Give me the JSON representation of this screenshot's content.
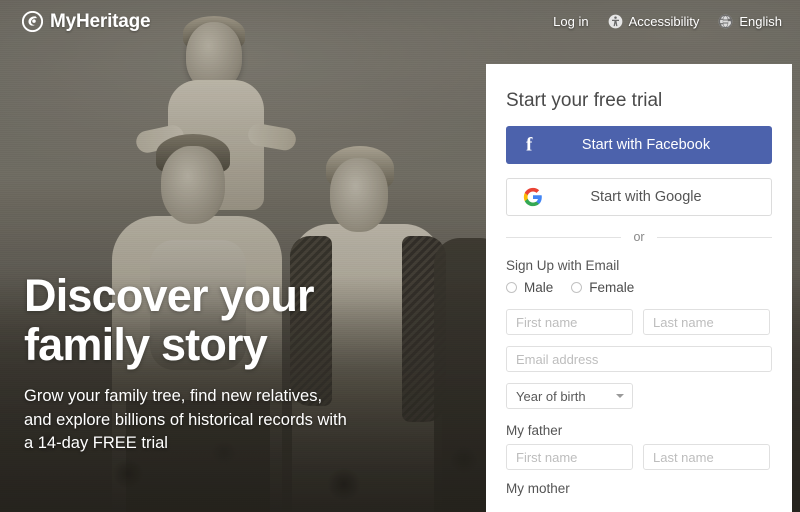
{
  "brand": {
    "name": "MyHeritage",
    "logo_icon": "myheritage-circle-leaf-icon"
  },
  "header": {
    "nav": [
      {
        "label": "Log in",
        "icon": null
      },
      {
        "label": "Accessibility",
        "icon": "accessibility-person-icon"
      },
      {
        "label": "English",
        "icon": "globe-icon"
      }
    ]
  },
  "hero": {
    "title_line1": "Discover your",
    "title_line2": "family story",
    "subtitle_line1": "Grow your family tree, find new relatives,",
    "subtitle_line2": "and explore billions of historical records with",
    "subtitle_line3": "a 14-day FREE trial"
  },
  "signup": {
    "title": "Start your free trial",
    "facebook_button": {
      "label": "Start with Facebook",
      "icon": "facebook-f-icon",
      "color": "#4c62ac"
    },
    "google_button": {
      "label": "Start with Google",
      "icon": "google-g-icon",
      "color": "#ffffff"
    },
    "divider_text": "or",
    "email_section_label": "Sign Up with Email",
    "gender": {
      "male_label": "Male",
      "female_label": "Female",
      "selected": null
    },
    "fields": {
      "first_name_placeholder": "First name",
      "last_name_placeholder": "Last name",
      "email_placeholder": "Email address",
      "first_name_value": "",
      "last_name_value": "",
      "email_value": ""
    },
    "year_of_birth": {
      "label": "Year of birth",
      "selected": "Year of birth",
      "caret_icon": "chevron-down-icon"
    },
    "father": {
      "label": "My father",
      "first_name_placeholder": "First name",
      "last_name_placeholder": "Last name"
    },
    "mother": {
      "label": "My mother"
    }
  }
}
